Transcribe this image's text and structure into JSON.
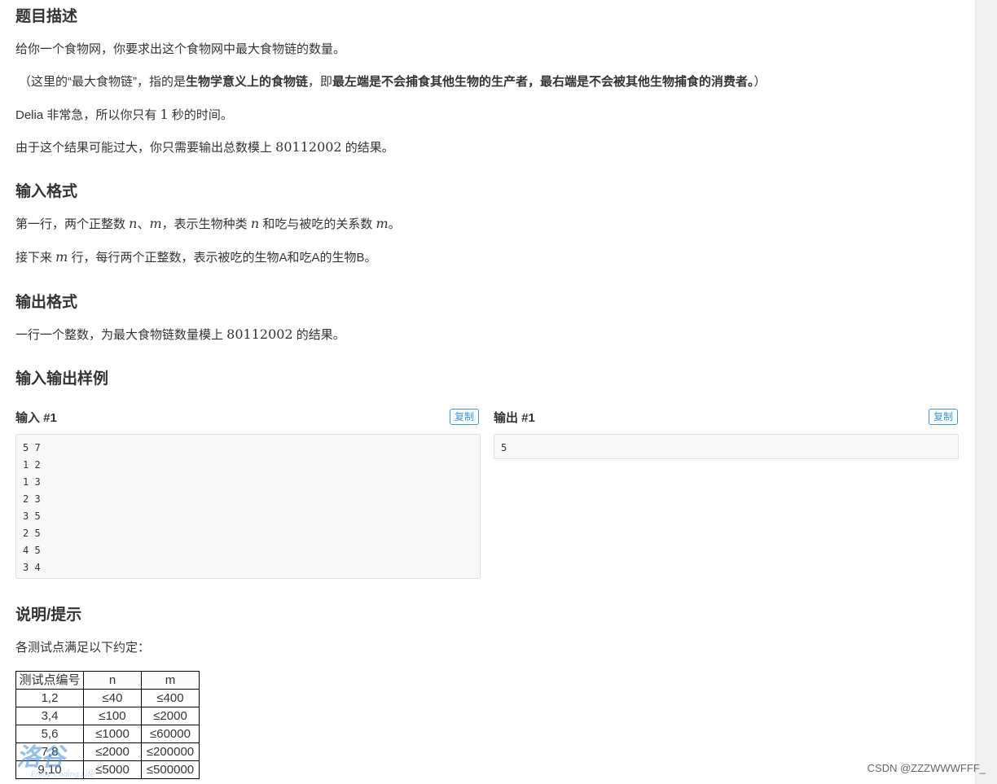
{
  "sections": {
    "description": {
      "heading": "题目描述",
      "line1": "给你一个食物网，你要求出这个食物网中最大食物链的数量。",
      "line2_a": "（这里的“最大食物链”，指的是",
      "line2_b": "生物学意义上的食物链",
      "line2_c": "，即",
      "line2_d": "最左端是不会捕食其他生物的生产者，最右端是不会被其他生物捕食的消费者。",
      "line2_e": "）",
      "line3_a": "Delia 非常急，所以你只有 ",
      "line3_num": "1",
      "line3_b": " 秒的时间。",
      "line4_a": "由于这个结果可能过大，你只需要输出总数模上 ",
      "line4_num": "80112002",
      "line4_b": " 的结果。"
    },
    "input_format": {
      "heading": "输入格式",
      "line1_a": "第一行，两个正整数 ",
      "var_n": "n",
      "sep": "、",
      "var_m": "m",
      "line1_b": "，表示生物种类 ",
      "line1_c": " 和吃与被吃的关系数 ",
      "line1_d": "。",
      "line2_a": "接下来 ",
      "line2_b": " 行，每行两个正整数，表示被吃的生物A和吃A的生物B。"
    },
    "output_format": {
      "heading": "输出格式",
      "line1_a": "一行一个整数，为最大食物链数量模上 ",
      "line1_num": "80112002",
      "line1_b": " 的结果。"
    },
    "samples": {
      "heading": "输入输出样例",
      "input_label": "输入 #1",
      "output_label": "输出 #1",
      "copy_label": "复制",
      "input_text": "5 7\n1 2\n1 3\n2 3\n3 5\n2 5\n4 5\n3 4",
      "output_text": "5"
    },
    "hints": {
      "heading": "说明/提示",
      "line1": "各测试点满足以下约定：",
      "table_headers": [
        "测试点编号",
        "n",
        "m"
      ],
      "table_rows": [
        [
          "1,2",
          "≤40",
          "≤400"
        ],
        [
          "3,4",
          "≤100",
          "≤2000"
        ],
        [
          "5,6",
          "≤1000",
          "≤60000"
        ],
        [
          "7,8",
          "≤2000",
          "≤200000"
        ],
        [
          "9,10",
          "≤5000",
          "≤500000"
        ]
      ]
    }
  },
  "watermark": {
    "logo_text": "洛谷",
    "tagline": "Enjoy Coding Life"
  },
  "footer": {
    "csdn_credit": "CSDN @ZZZWWWFFF_"
  }
}
